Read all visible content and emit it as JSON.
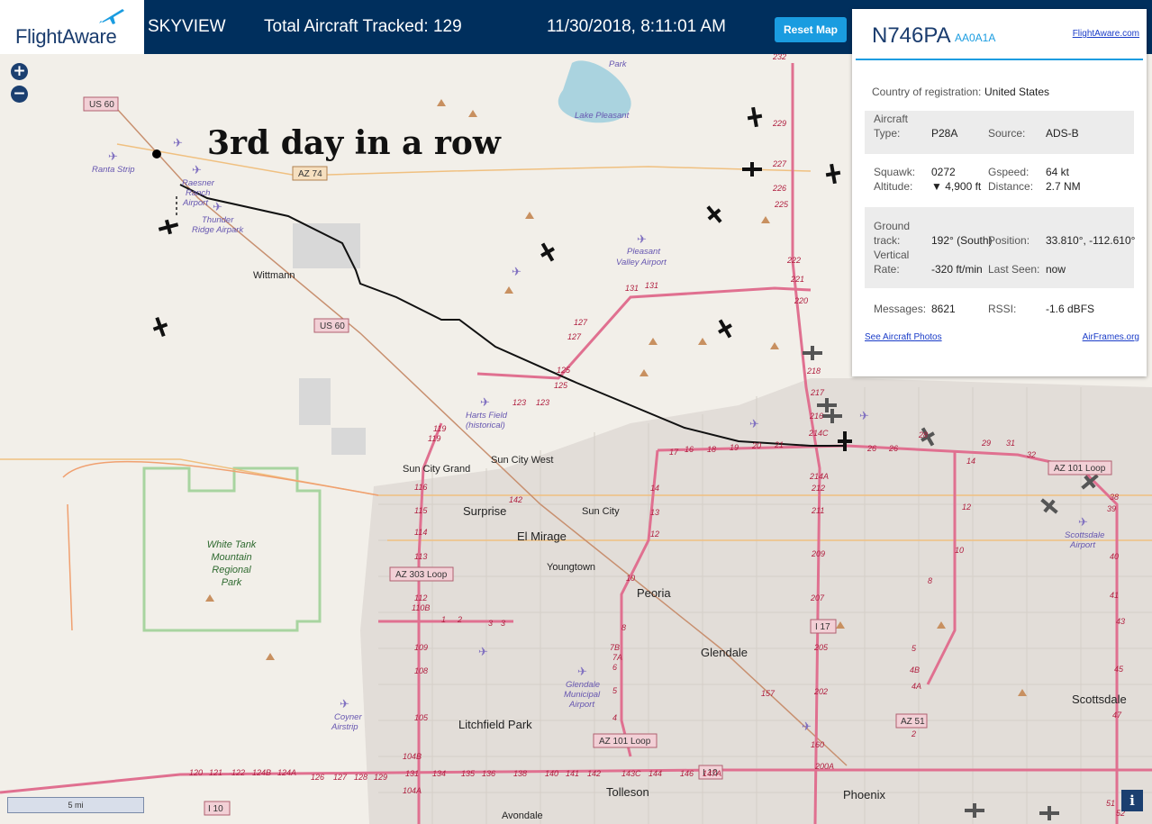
{
  "header": {
    "logo": "FlightAware",
    "product": "SKYVIEW",
    "tracked": "Total Aircraft Tracked: 129",
    "datetime": "11/30/2018, 8:11:01 AM",
    "reset_label": "Reset Map"
  },
  "annotation": "3rd day in a row",
  "zoom": {
    "in": "+",
    "out": "−"
  },
  "panel": {
    "registration": "N746PA",
    "hex": "AA0A1A",
    "fa_link": "FlightAware.com",
    "country_label": "Country of registration:",
    "country": "United States",
    "aircraft_type_label": "Aircraft Type:",
    "aircraft_type": "P28A",
    "source_label": "Source:",
    "source": "ADS-B",
    "squawk_label": "Squawk:",
    "squawk": "0272",
    "gspeed_label": "Gspeed:",
    "gspeed": "64 kt",
    "altitude_label": "Altitude:",
    "altitude": "▼ 4,900 ft",
    "distance_label": "Distance:",
    "distance": "2.7 NM",
    "ground_track_label": "Ground track:",
    "ground_track": "192° (South)",
    "position_label": "Position:",
    "position": "33.810°, -112.610°",
    "vertical_rate_label": "Vertical Rate:",
    "vertical_rate": "-320 ft/min",
    "last_seen_label": "Last Seen:",
    "last_seen": "now",
    "messages_label": "Messages:",
    "messages": "8621",
    "rssi_label": "RSSI:",
    "rssi": "-1.6 dBFS",
    "photos_link": "See Aircraft Photos",
    "airframes_link": "AirFrames.org"
  },
  "map": {
    "places": [
      "Wittmann",
      "Sun City Grand",
      "Sun City West",
      "Surprise",
      "Sun City",
      "El Mirage",
      "Youngtown",
      "Peoria",
      "Glendale",
      "Litchfield Park",
      "Tolleson",
      "Avondale",
      "Phoenix",
      "Scottsdale"
    ],
    "airports": [
      "Ranta Strip",
      "Raesner Ranch Airport",
      "Thunder Ridge Airpark",
      "Pleasant Valley Airport",
      "Harts Field (historical)",
      "Glendale Municipal Airport",
      "Coyner Airstrip",
      "Scottsdale Airport",
      "Lake Pleasant",
      "Park"
    ],
    "parks": [
      "White Tank Mountain Regional Park"
    ],
    "shields": [
      "US 60",
      "AZ 74",
      "US 60",
      "AZ 303 Loop",
      "AZ 101 Loop",
      "AZ 101 Loop",
      "I 17",
      "AZ 51",
      "I 10",
      "I 10"
    ],
    "scale": "5 mi"
  },
  "colors": {
    "header": "#002f5d",
    "accent": "#1a9ce0",
    "road": "#e07090",
    "track": "#111111"
  }
}
